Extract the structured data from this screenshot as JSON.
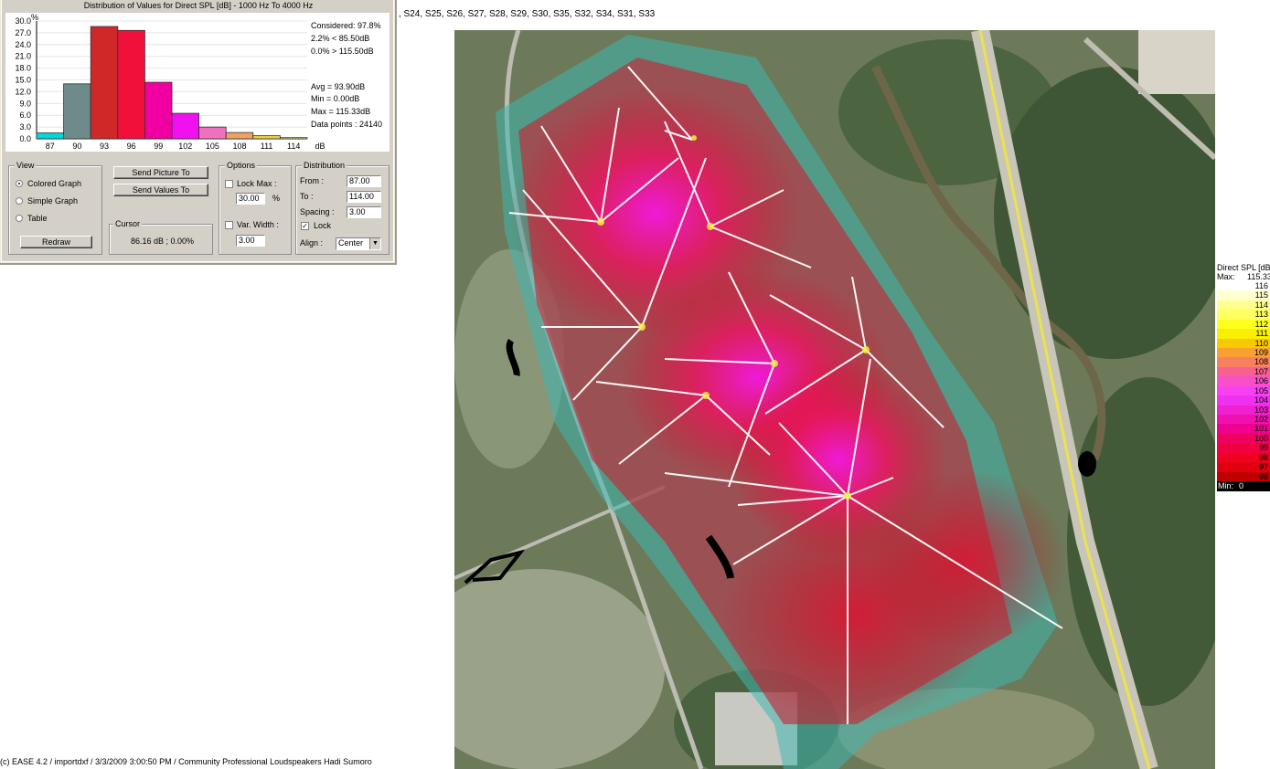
{
  "dialog": {
    "title": "Distribution of Values for Direct SPL [dB] - 1000 Hz To 4000 Hz",
    "y_unit": "%",
    "x_unit": "dB",
    "stats": {
      "considered": "Considered: 97.8%",
      "below": "2.2%  < 85.50dB",
      "above": "0.0%  > 115.50dB",
      "avg": "Avg = 93.90dB",
      "min": "Min = 0.00dB",
      "max": "Max = 115.33dB",
      "points": "Data points : 24140"
    },
    "view": {
      "label": "View",
      "options": [
        "Colored Graph",
        "Simple Graph",
        "Table"
      ],
      "selected": "Colored Graph",
      "redraw": "Redraw"
    },
    "send_picture": "Send Picture To",
    "send_values": "Send Values To",
    "cursor": {
      "label": "Cursor",
      "value": "86.16 dB ; 0.00%"
    },
    "options": {
      "label": "Options",
      "lock_max": "Lock Max :",
      "lock_max_value": "30.00",
      "lock_max_unit": "%",
      "var_width": "Var. Width :",
      "var_width_value": "3.00"
    },
    "distribution": {
      "label": "Distribution",
      "from_label": "From :",
      "from": "87.00",
      "to_label": "To :",
      "to": "114.00",
      "spacing_label": "Spacing :",
      "spacing": "3.00",
      "lock": "Lock",
      "align_label": "Align :",
      "align": "Center"
    }
  },
  "chart_data": {
    "type": "bar",
    "title": "Distribution of Values for Direct SPL [dB] - 1000 Hz To 4000 Hz",
    "ylabel": "%",
    "xlabel": "dB",
    "ylim": [
      0,
      30
    ],
    "yticks": [
      "30.0",
      "27.0",
      "24.0",
      "21.0",
      "18.0",
      "15.0",
      "12.0",
      "9.0",
      "6.0",
      "3.0",
      "0.0"
    ],
    "categories": [
      "87",
      "90",
      "93",
      "96",
      "99",
      "102",
      "105",
      "108",
      "111",
      "114"
    ],
    "values": [
      1.5,
      14.0,
      28.6,
      27.6,
      14.4,
      6.5,
      3.0,
      1.6,
      0.8,
      0.3
    ],
    "colors": [
      "#00d8d8",
      "#6e8a8a",
      "#d02828",
      "#f0103a",
      "#f000a0",
      "#f010f0",
      "#f070c0",
      "#f0a060",
      "#e8d040",
      "#f0f080"
    ]
  },
  "header_sources": ", S24, S25, S26, S27, S28, S29, S30, S35, S32, S34, S31, S33",
  "footer": "(c) EASE 4.2  / importdxf  / 3/3/2009 3:00:50 PM / Community Professional Loudspeakers Hadi Sumoro",
  "legend": {
    "title": "Direct SPL [dB]",
    "max_label": "Max:",
    "max_value": "115.33",
    "min_label": "Min:",
    "min_value": "0",
    "levels": [
      {
        "v": "116",
        "c": "#ffffff"
      },
      {
        "v": "115",
        "c": "#ffffd0"
      },
      {
        "v": "114",
        "c": "#ffff90"
      },
      {
        "v": "113",
        "c": "#ffff60"
      },
      {
        "v": "112",
        "c": "#ffff20"
      },
      {
        "v": "111",
        "c": "#f8f000"
      },
      {
        "v": "110",
        "c": "#f8c800"
      },
      {
        "v": "109",
        "c": "#f8a030"
      },
      {
        "v": "108",
        "c": "#f88060"
      },
      {
        "v": "107",
        "c": "#f86090"
      },
      {
        "v": "106",
        "c": "#f850c8"
      },
      {
        "v": "105",
        "c": "#f840f0"
      },
      {
        "v": "104",
        "c": "#f030f0"
      },
      {
        "v": "103",
        "c": "#f020d0"
      },
      {
        "v": "102",
        "c": "#f010b0"
      },
      {
        "v": "101",
        "c": "#f00090"
      },
      {
        "v": "100",
        "c": "#f00060"
      },
      {
        "v": "99",
        "c": "#f00040"
      },
      {
        "v": "98",
        "c": "#f00020"
      },
      {
        "v": "97",
        "c": "#e00010"
      },
      {
        "v": "96",
        "c": "#c00000"
      }
    ]
  }
}
